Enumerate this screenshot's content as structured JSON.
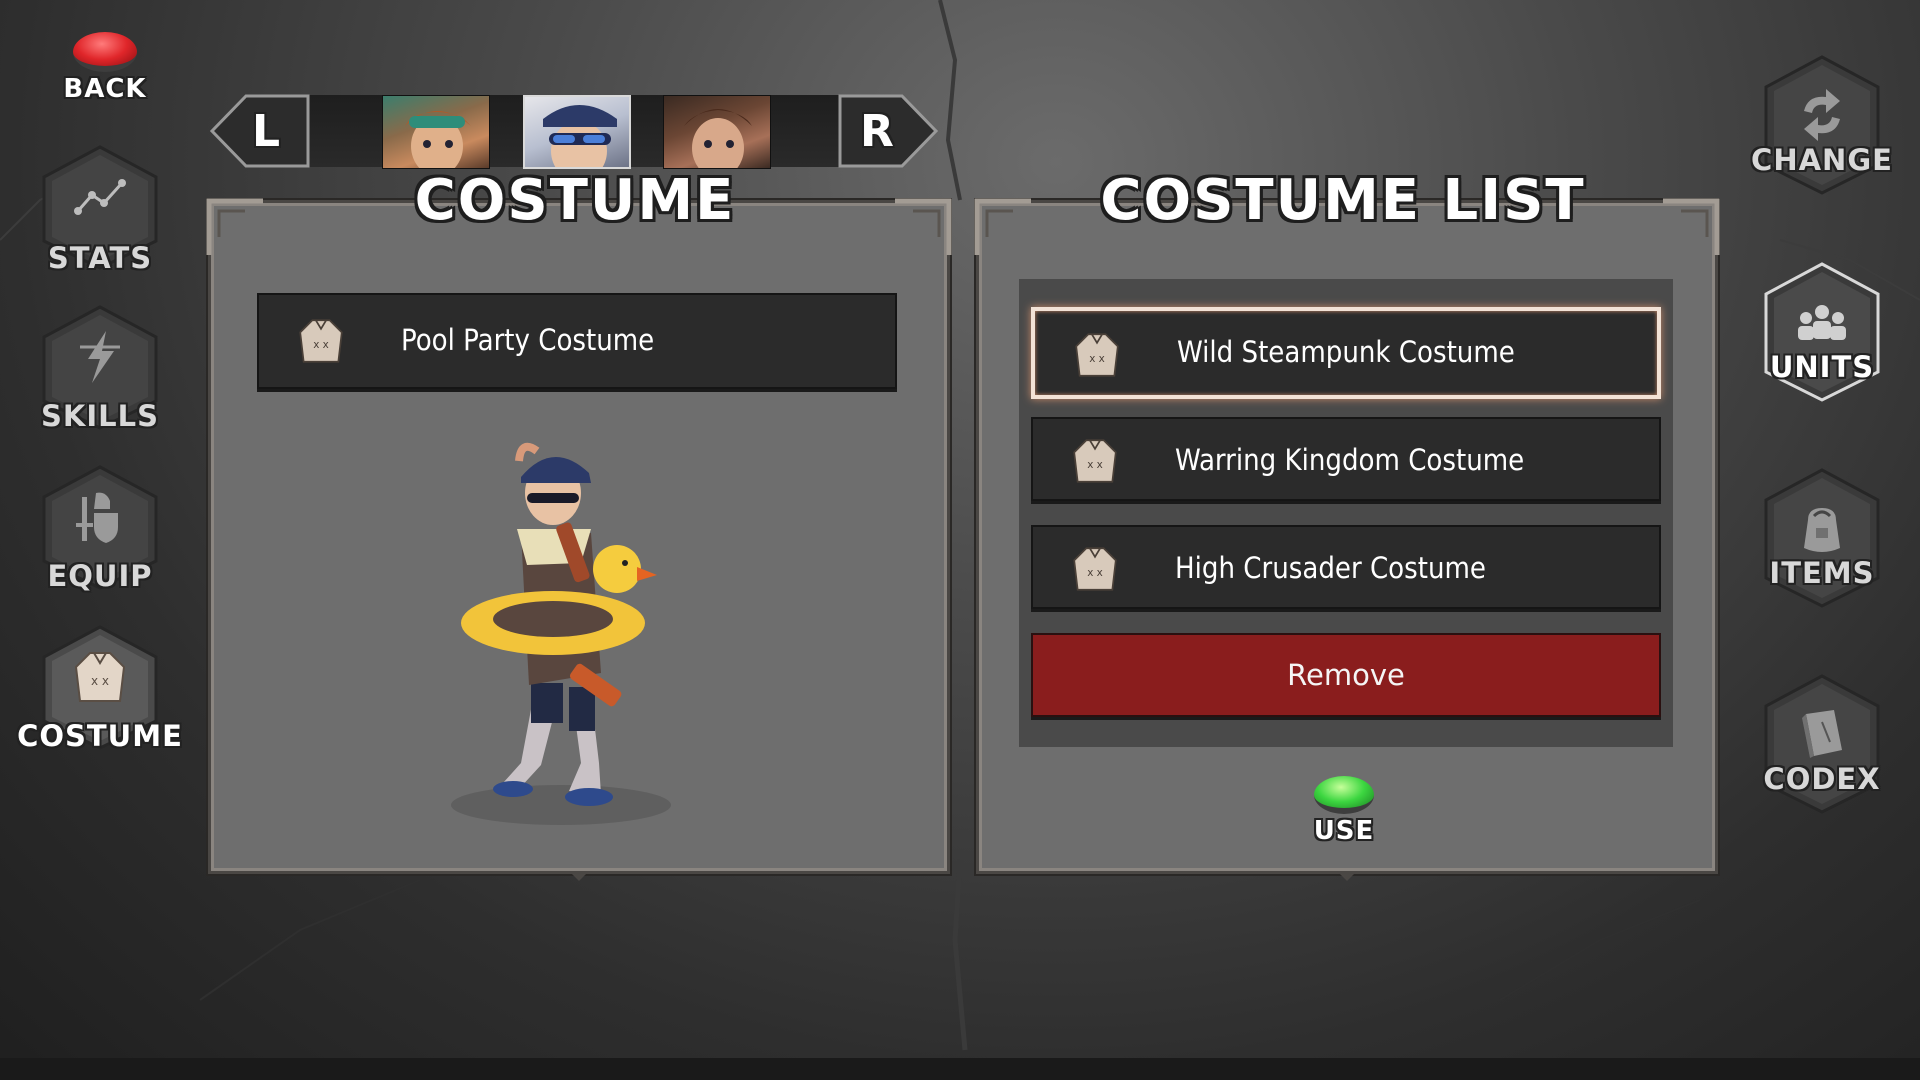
{
  "back": {
    "label": "BACK"
  },
  "left_nav": [
    {
      "id": "stats",
      "label": "STATS",
      "icon": "stats-icon"
    },
    {
      "id": "skills",
      "label": "SKILLS",
      "icon": "skills-icon"
    },
    {
      "id": "equip",
      "label": "EQUIP",
      "icon": "equip-icon"
    },
    {
      "id": "costume",
      "label": "COSTUME",
      "icon": "costume-icon",
      "active": true
    }
  ],
  "right_nav": [
    {
      "id": "change",
      "label": "CHANGE",
      "icon": "change-icon"
    },
    {
      "id": "units",
      "label": "UNITS",
      "icon": "units-icon"
    },
    {
      "id": "items",
      "label": "ITEMS",
      "icon": "items-icon"
    },
    {
      "id": "codex",
      "label": "CODEX",
      "icon": "codex-icon"
    }
  ],
  "selector": {
    "left_label": "L",
    "right_label": "R",
    "portraits": [
      "portrait-left",
      "portrait-selected",
      "portrait-right"
    ]
  },
  "costume_panel": {
    "title": "COSTUME",
    "equipped": "Pool Party Costume"
  },
  "costume_list_panel": {
    "title": "COSTUME LIST",
    "items": [
      {
        "label": "Wild Steampunk Costume",
        "selected": true
      },
      {
        "label": "Warring Kingdom Costume",
        "selected": false
      },
      {
        "label": "High Crusader Costume",
        "selected": false
      }
    ],
    "remove_label": "Remove",
    "use_label": "USE"
  },
  "colors": {
    "panel": "#6e6e6e",
    "row": "#2b2b2b",
    "remove": "#8a1d1d",
    "selected_border": "#f2e2d6",
    "back_button": "#e0262a",
    "use_button": "#3cd640"
  }
}
